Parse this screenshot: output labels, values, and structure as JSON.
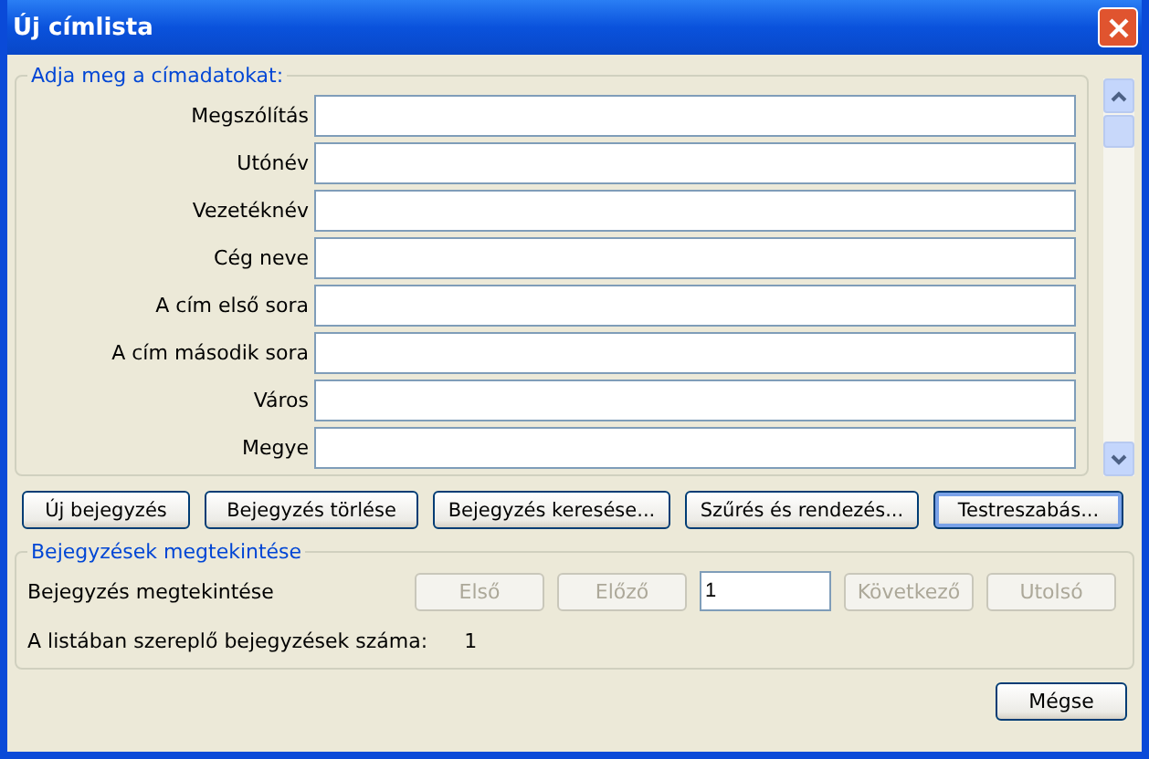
{
  "window": {
    "title": "Új címlista"
  },
  "address_group": {
    "legend": "Adja meg a címadatokat:",
    "fields": [
      {
        "label": "Megszólítás"
      },
      {
        "label": "Utónév"
      },
      {
        "label": "Vezetéknév"
      },
      {
        "label": "Cég neve"
      },
      {
        "label": "A cím első sora"
      },
      {
        "label": "A cím második sora"
      },
      {
        "label": "Város"
      },
      {
        "label": "Megye"
      }
    ]
  },
  "buttons": [
    {
      "label": "Új bejegyzés",
      "focused": false
    },
    {
      "label": "Bejegyzés törlése",
      "focused": false
    },
    {
      "label": "Bejegyzés keresése...",
      "focused": false
    },
    {
      "label": "Szűrés és rendezés...",
      "focused": false
    },
    {
      "label": "Testreszabás...",
      "focused": true
    }
  ],
  "view_group": {
    "legend": "Bejegyzések megtekintése",
    "navigate_label": "Bejegyzés megtekintése",
    "controls": [
      {
        "kind": "button",
        "label": "Első",
        "disabled": true
      },
      {
        "kind": "button",
        "label": "Előző",
        "disabled": true
      },
      {
        "kind": "field",
        "value": "1"
      },
      {
        "kind": "button",
        "label": "Következő",
        "disabled": true
      },
      {
        "kind": "button",
        "label": "Utolsó",
        "disabled": true
      }
    ],
    "count_label": "A listában szereplő bejegyzések száma:",
    "count_value": "1"
  },
  "cancel_button": {
    "label": "Mégse"
  }
}
